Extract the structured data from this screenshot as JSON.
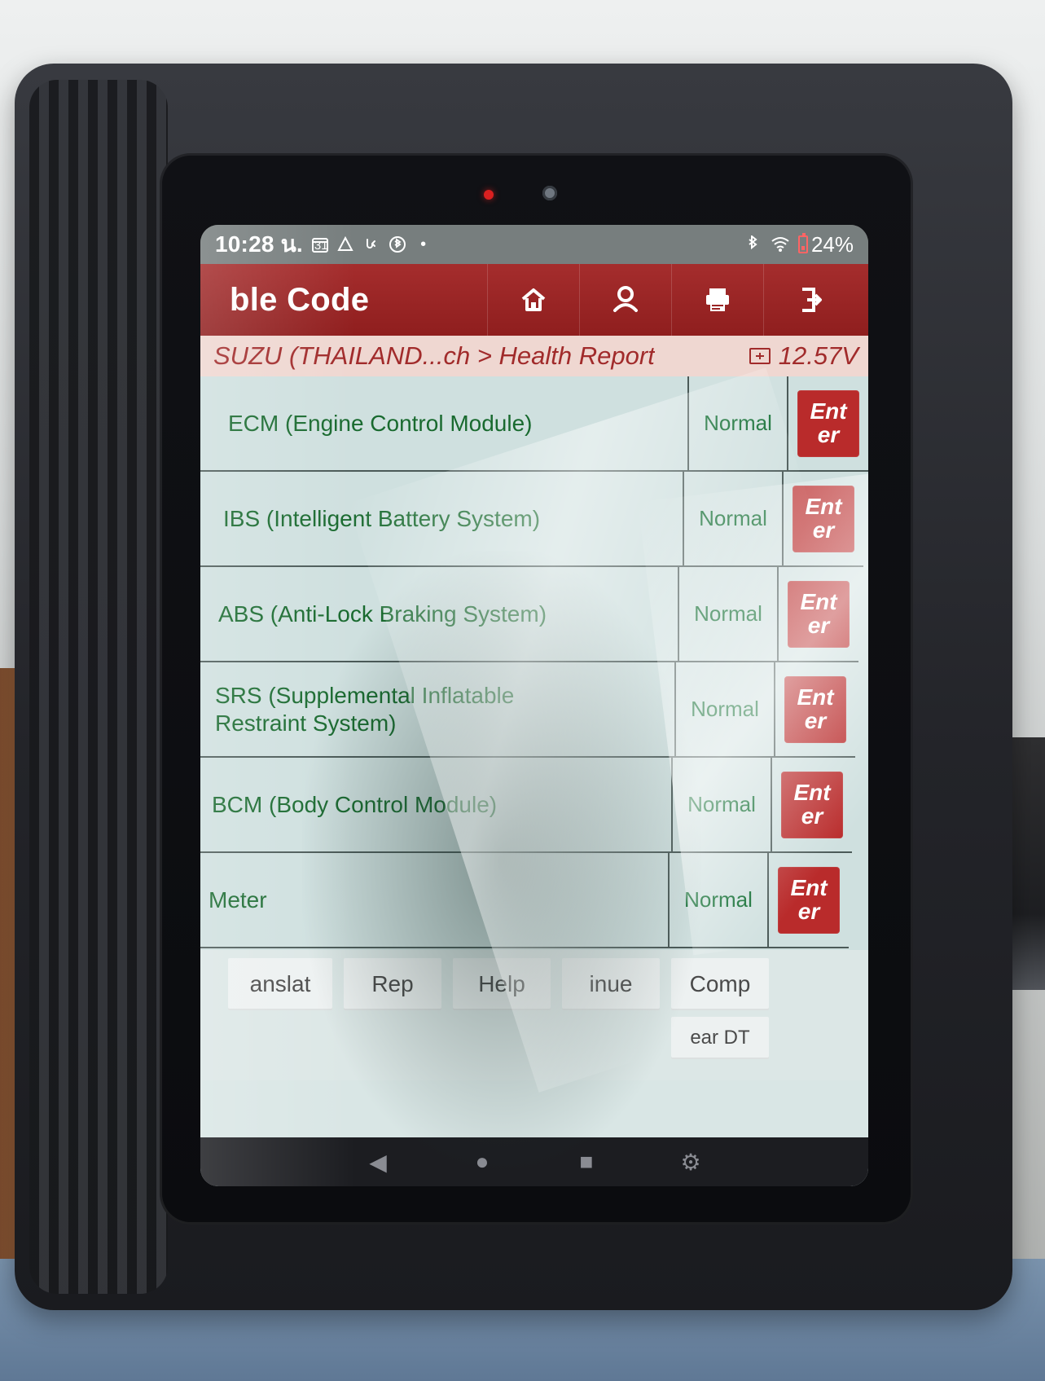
{
  "status": {
    "time": "10:28 น.",
    "calendar_day": "31",
    "battery": "24%",
    "icons": [
      "calendar-icon",
      "drive-icon",
      "usb-debug-icon",
      "bluetooth-circle-icon",
      "dot-icon",
      "bluetooth-icon",
      "wifi-icon",
      "battery-icon"
    ]
  },
  "header": {
    "title": "ble Code",
    "actions": [
      {
        "name": "home-icon"
      },
      {
        "name": "profile-icon"
      },
      {
        "name": "printer-icon"
      },
      {
        "name": "exit-icon"
      }
    ]
  },
  "breadcrumb": {
    "path": "SUZU (THAILAND...ch > Health Report",
    "voltage": "12.57V"
  },
  "modules": [
    {
      "name": "ECM (Engine Control Module)",
      "status": "Normal",
      "action": "Ent\ner"
    },
    {
      "name": "IBS (Intelligent Battery System)",
      "status": "Normal",
      "action": "Ent\ner"
    },
    {
      "name": "ABS (Anti-Lock Braking System)",
      "status": "Normal",
      "action": "Ent\ner"
    },
    {
      "name": "SRS (Supplemental Inflatable\nRestraint System)",
      "status": "Normal",
      "action": "Ent\ner"
    },
    {
      "name": "BCM (Body Control Module)",
      "status": "Normal",
      "action": "Ent\ner"
    },
    {
      "name": "Meter",
      "status": "Normal",
      "action": "Ent\ner"
    }
  ],
  "toolbar": {
    "buttons": [
      "anslat",
      "Rep",
      "Help",
      "inue",
      "Comp",
      "ear DT"
    ]
  },
  "nav": {
    "back": "◀",
    "home": "●",
    "recent": "■",
    "extra": "⚙"
  }
}
